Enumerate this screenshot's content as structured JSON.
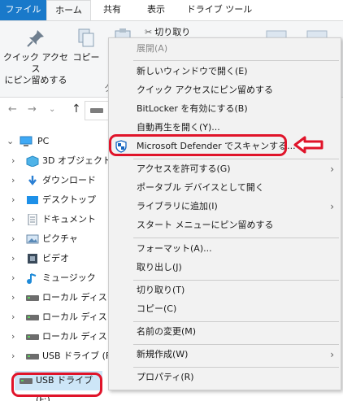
{
  "ribbon": {
    "tabs": [
      "ファイル",
      "ホーム",
      "共有",
      "表示",
      "ドライブ ツール"
    ],
    "pin_label_1": "クイック アクセス",
    "pin_label_2": "にピン留めする",
    "copy_label": "コピー",
    "cut_label": "切り取り",
    "group_label_partial": "ク"
  },
  "tree": {
    "pc": "PC",
    "items": [
      {
        "label": "3D オブジェクト",
        "icon": "3d-objects-icon"
      },
      {
        "label": "ダウンロード",
        "icon": "download-icon"
      },
      {
        "label": "デスクトップ",
        "icon": "desktop-icon"
      },
      {
        "label": "ドキュメント",
        "icon": "document-icon"
      },
      {
        "label": "ピクチャ",
        "icon": "picture-icon"
      },
      {
        "label": "ビデオ",
        "icon": "video-icon"
      },
      {
        "label": "ミュージック",
        "icon": "music-icon"
      },
      {
        "label": "ローカル ディスク (",
        "icon": "drive-icon"
      },
      {
        "label": "ローカル ディスク (",
        "icon": "drive-icon"
      },
      {
        "label": "ローカル ディスク (",
        "icon": "drive-icon"
      },
      {
        "label": "USB ドライブ (F:)",
        "icon": "usb-drive-icon"
      }
    ],
    "usb_root": "USB ドライブ (F:)"
  },
  "context_menu": {
    "expand": "展開(A)",
    "open_new_window": "新しいウィンドウで開く(E)",
    "pin_quick_access": "クイック アクセスにピン留めする",
    "bitlocker": "BitLocker を有効にする(B)",
    "autoplay": "自動再生を開く(Y)...",
    "defender_scan": "Microsoft Defender でスキャンする...",
    "give_access": "アクセスを許可する(G)",
    "open_portable": "ポータブル デバイスとして開く",
    "add_to_library": "ライブラリに追加(I)",
    "pin_start": "スタート メニューにピン留めする",
    "format": "フォーマット(A)...",
    "eject": "取り出し(J)",
    "cut": "切り取り(T)",
    "copy": "コピー(C)",
    "rename": "名前の変更(M)",
    "new": "新規作成(W)",
    "properties": "プロパティ(R)"
  },
  "colors": {
    "accent": "#1979ca",
    "highlight_red": "#e0142a",
    "selection": "#cde6f7",
    "menu_bg": "#f2f2f2"
  }
}
